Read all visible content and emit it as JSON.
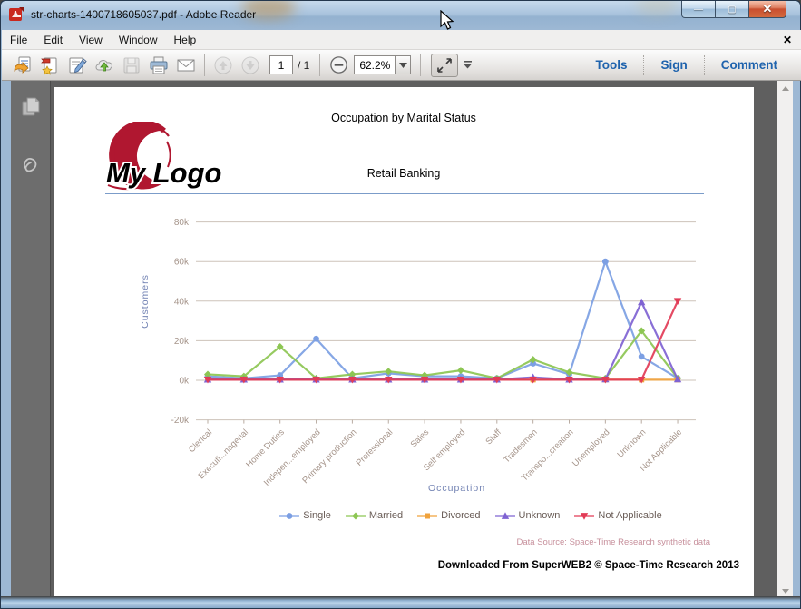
{
  "window": {
    "title": "str-charts-1400718605037.pdf - Adobe Reader",
    "controls": {
      "minimize": "—",
      "maximize": "▢",
      "close": "✕"
    }
  },
  "menu": {
    "items": [
      "File",
      "Edit",
      "View",
      "Window",
      "Help"
    ],
    "close_label": "✕"
  },
  "toolbar": {
    "icons": [
      "open-file",
      "create-pdf-online",
      "sign-document",
      "upload-cloud",
      "save",
      "print",
      "email",
      "previous-page",
      "next-page",
      "zoom-out",
      "fit-width",
      "toolbar-overflow"
    ],
    "page_current": "1",
    "page_total": "/ 1",
    "zoom_level": "62.2%",
    "links": [
      "Tools",
      "Sign",
      "Comment"
    ]
  },
  "sidebar": {
    "icons": [
      "page-thumbnails",
      "attachments"
    ]
  },
  "document": {
    "page_title": "Occupation by Marital Status",
    "subtitle": "Retail Banking",
    "logo_text": "My Logo",
    "data_source": "Data Source: Space-Time Research synthetic data",
    "footer": "Downloaded From SuperWEB2 © Space-Time Research 2013"
  },
  "chart_data": {
    "type": "line",
    "title": "Occupation by Marital Status",
    "xlabel": "Occupation",
    "ylabel": "Customers",
    "grid": true,
    "legend_position": "bottom",
    "ylim": [
      -20000,
      90000
    ],
    "yticks": [
      {
        "label": "80k",
        "value": 80000
      },
      {
        "label": "60k",
        "value": 60000
      },
      {
        "label": "40k",
        "value": 40000
      },
      {
        "label": "20k",
        "value": 20000
      },
      {
        "label": "0k",
        "value": 0
      },
      {
        "label": "-20k",
        "value": -20000
      }
    ],
    "categories": [
      "Clerical",
      "Executi...nagerial",
      "Home Duties",
      "Indepen...employed",
      "Primary production",
      "Professional",
      "Sales",
      "Self employed",
      "Staff",
      "Tradesmen",
      "Transpo...creation",
      "Unemployed",
      "Unknown",
      "Not Applicable"
    ],
    "series": [
      {
        "name": "Single",
        "color": "#7c9fe3",
        "marker": "circle",
        "values": [
          2000,
          1000,
          2500,
          21000,
          1000,
          3500,
          2000,
          2000,
          1000,
          8500,
          3000,
          60000,
          12000,
          1000
        ]
      },
      {
        "name": "Married",
        "color": "#8dc653",
        "marker": "diamond",
        "values": [
          3000,
          2000,
          17000,
          1000,
          3000,
          4500,
          2500,
          5000,
          1000,
          10500,
          4000,
          1000,
          25000,
          1000
        ]
      },
      {
        "name": "Divorced",
        "color": "#f0a23c",
        "marker": "square",
        "values": [
          300,
          300,
          300,
          300,
          300,
          300,
          300,
          300,
          300,
          300,
          300,
          300,
          300,
          300
        ]
      },
      {
        "name": "Unknown",
        "color": "#7f63d2",
        "marker": "triangle",
        "values": [
          400,
          400,
          400,
          400,
          400,
          400,
          400,
          400,
          400,
          1500,
          400,
          500,
          39500,
          500
        ]
      },
      {
        "name": "Not Applicable",
        "color": "#e23b56",
        "marker": "triangle-down",
        "values": [
          300,
          300,
          300,
          300,
          300,
          300,
          300,
          300,
          300,
          300,
          300,
          300,
          300,
          40000
        ]
      }
    ]
  }
}
